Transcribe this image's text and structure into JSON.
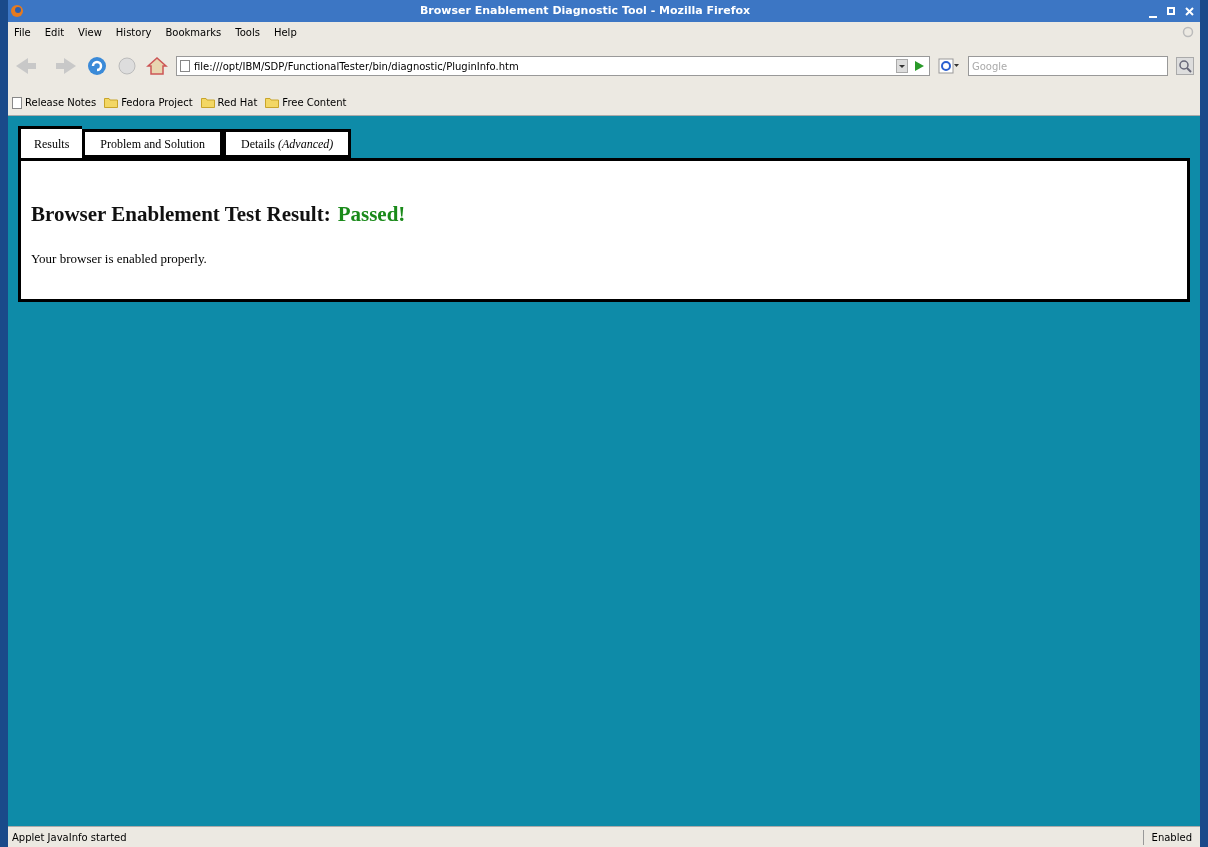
{
  "window": {
    "title": "Browser Enablement Diagnostic Tool - Mozilla Firefox"
  },
  "menu": [
    "File",
    "Edit",
    "View",
    "History",
    "Bookmarks",
    "Tools",
    "Help"
  ],
  "address": {
    "value": "file:///opt/IBM/SDP/FunctionalTester/bin/diagnostic/PluginInfo.htm"
  },
  "search": {
    "placeholder": "Google"
  },
  "bookmarks": [
    {
      "label": "Release Notes",
      "kind": "page"
    },
    {
      "label": "Fedora Project",
      "kind": "folder"
    },
    {
      "label": "Red Hat",
      "kind": "folder"
    },
    {
      "label": "Free Content",
      "kind": "folder"
    }
  ],
  "tabs": [
    {
      "label": "Results",
      "selected": true
    },
    {
      "label": "Problem and Solution",
      "selected": false
    },
    {
      "label": "Details *(Advanced)*",
      "selected": false
    }
  ],
  "result": {
    "heading": "Browser Enablement Test Result:",
    "outcome": "Passed!",
    "message": "Your browser is enabled properly."
  },
  "status_bar": {
    "text": "Applet JavaInfo started",
    "right": "Enabled"
  }
}
